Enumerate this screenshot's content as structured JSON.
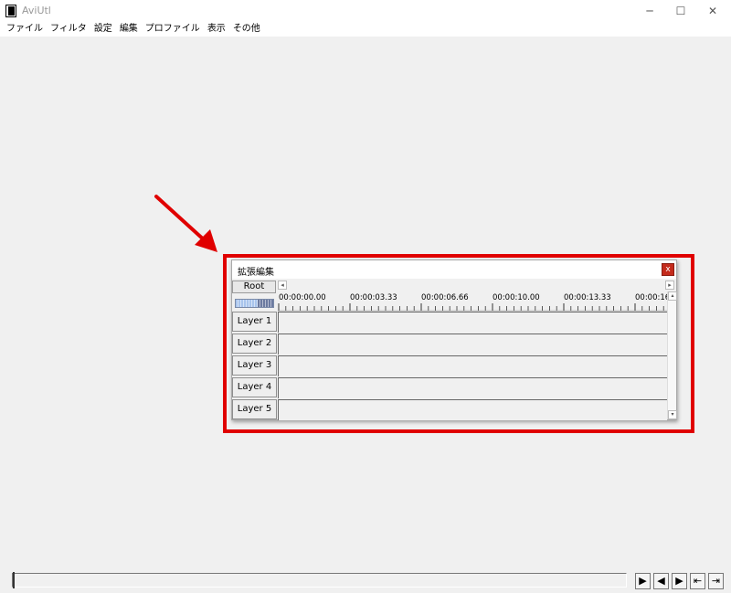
{
  "window": {
    "title": "AviUtl",
    "minimize": "─",
    "maximize": "☐",
    "close": "✕"
  },
  "menu": [
    "ファイル",
    "フィルタ",
    "設定",
    "編集",
    "プロファイル",
    "表示",
    "その他"
  ],
  "ext_edit": {
    "title": "拡張編集",
    "close": "x",
    "root_label": "Root",
    "timestamps": [
      "00:00:00.00",
      "00:00:03.33",
      "00:00:06.66",
      "00:00:10.00",
      "00:00:13.33",
      "00:00:16"
    ],
    "layers": [
      "Layer 1",
      "Layer 2",
      "Layer 3",
      "Layer 4",
      "Layer 5"
    ]
  },
  "highlight_color": "#e00000",
  "playback": {
    "buttons": [
      {
        "name": "play-button",
        "glyph": "▶"
      },
      {
        "name": "prev-frame-button",
        "glyph": "◀"
      },
      {
        "name": "next-frame-button",
        "glyph": "▶"
      },
      {
        "name": "go-start-button",
        "glyph": "⇤"
      },
      {
        "name": "go-end-button",
        "glyph": "⇥"
      }
    ]
  }
}
